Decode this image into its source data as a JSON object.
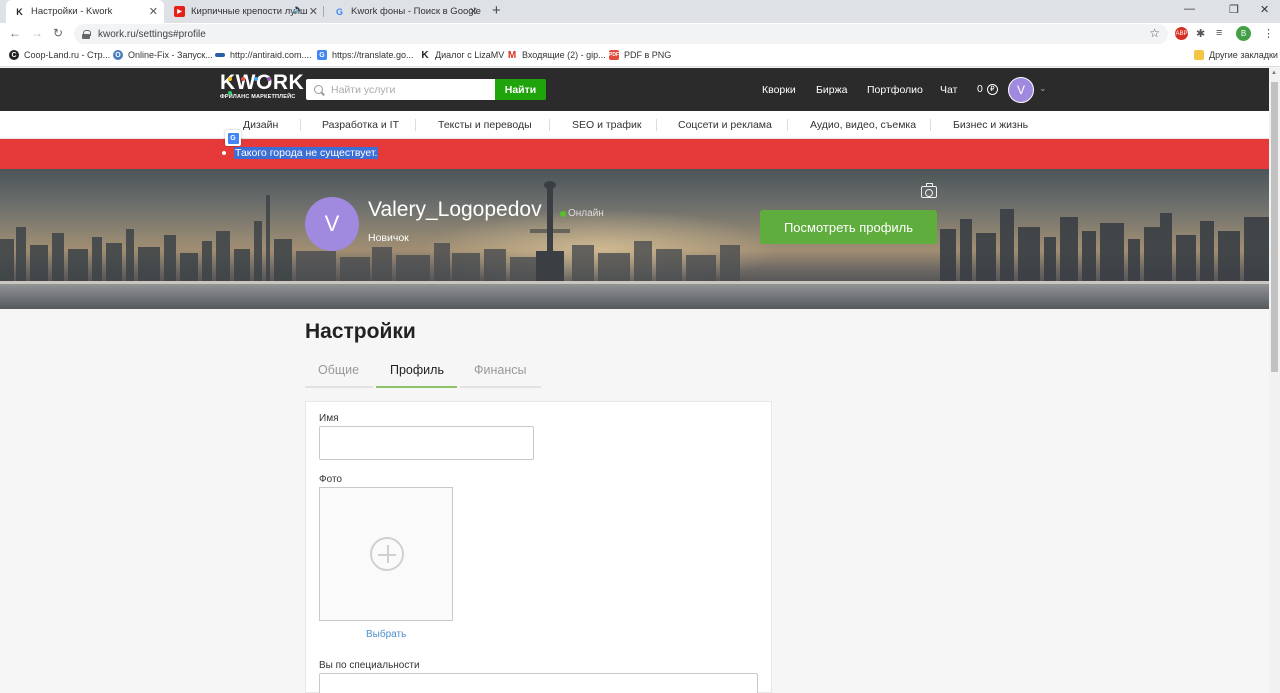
{
  "browser": {
    "tabs": [
      {
        "title": "Настройки - Kwork",
        "active": true
      },
      {
        "title": "Кирпичные крепости лучш",
        "active": false
      },
      {
        "title": "Kwork фоны - Поиск в Google",
        "active": false
      }
    ],
    "url": "kwork.ru/settings#profile",
    "bookmarks": [
      "Coop-Land.ru - Стр...",
      "Online-Fix - Запуск...",
      "http://antiraid.com....",
      "https://translate.go...",
      "Диалог с LizaMV",
      "Входящие (2) - gip...",
      "PDF в PNG",
      "Другие закладки"
    ],
    "profile_initial": "В",
    "ext_badge": "ABP"
  },
  "header": {
    "logo": "KWORK",
    "logo_sub": "ФРИЛАНС МАРКЕТПЛЕЙС",
    "search_placeholder": "Найти услуги",
    "search_button": "Найти",
    "nav": [
      "Кворки",
      "Биржа",
      "Портфолио",
      "Чат"
    ],
    "balance": "0",
    "currency": "₽",
    "user_initial": "V"
  },
  "categories": [
    "Дизайн",
    "Разработка и IT",
    "Тексты и переводы",
    "SEO и трафик",
    "Соцсети и реклама",
    "Аудио, видео, съемка",
    "Бизнес и жизнь"
  ],
  "error": {
    "message": "Такого города не существует."
  },
  "profile": {
    "initial": "V",
    "username": "Valery_Logopedov",
    "status": "Онлайн",
    "level": "Новичок",
    "view_button": "Посмотреть профиль"
  },
  "settings": {
    "title": "Настройки",
    "tabs": [
      "Общие",
      "Профиль",
      "Финансы"
    ],
    "active_tab": "Профиль",
    "fields": {
      "name_label": "Имя",
      "name_value": "",
      "photo_label": "Фото",
      "choose_label": "Выбрать",
      "specialty_label": "Вы по специальности",
      "specialty_value": ""
    }
  },
  "colors": {
    "accent_green": "#5fad3c",
    "search_green": "#1fa40b",
    "error_red": "#e63a3a",
    "avatar_purple": "#a08ae0",
    "tab_underline": "#8ec26a"
  }
}
